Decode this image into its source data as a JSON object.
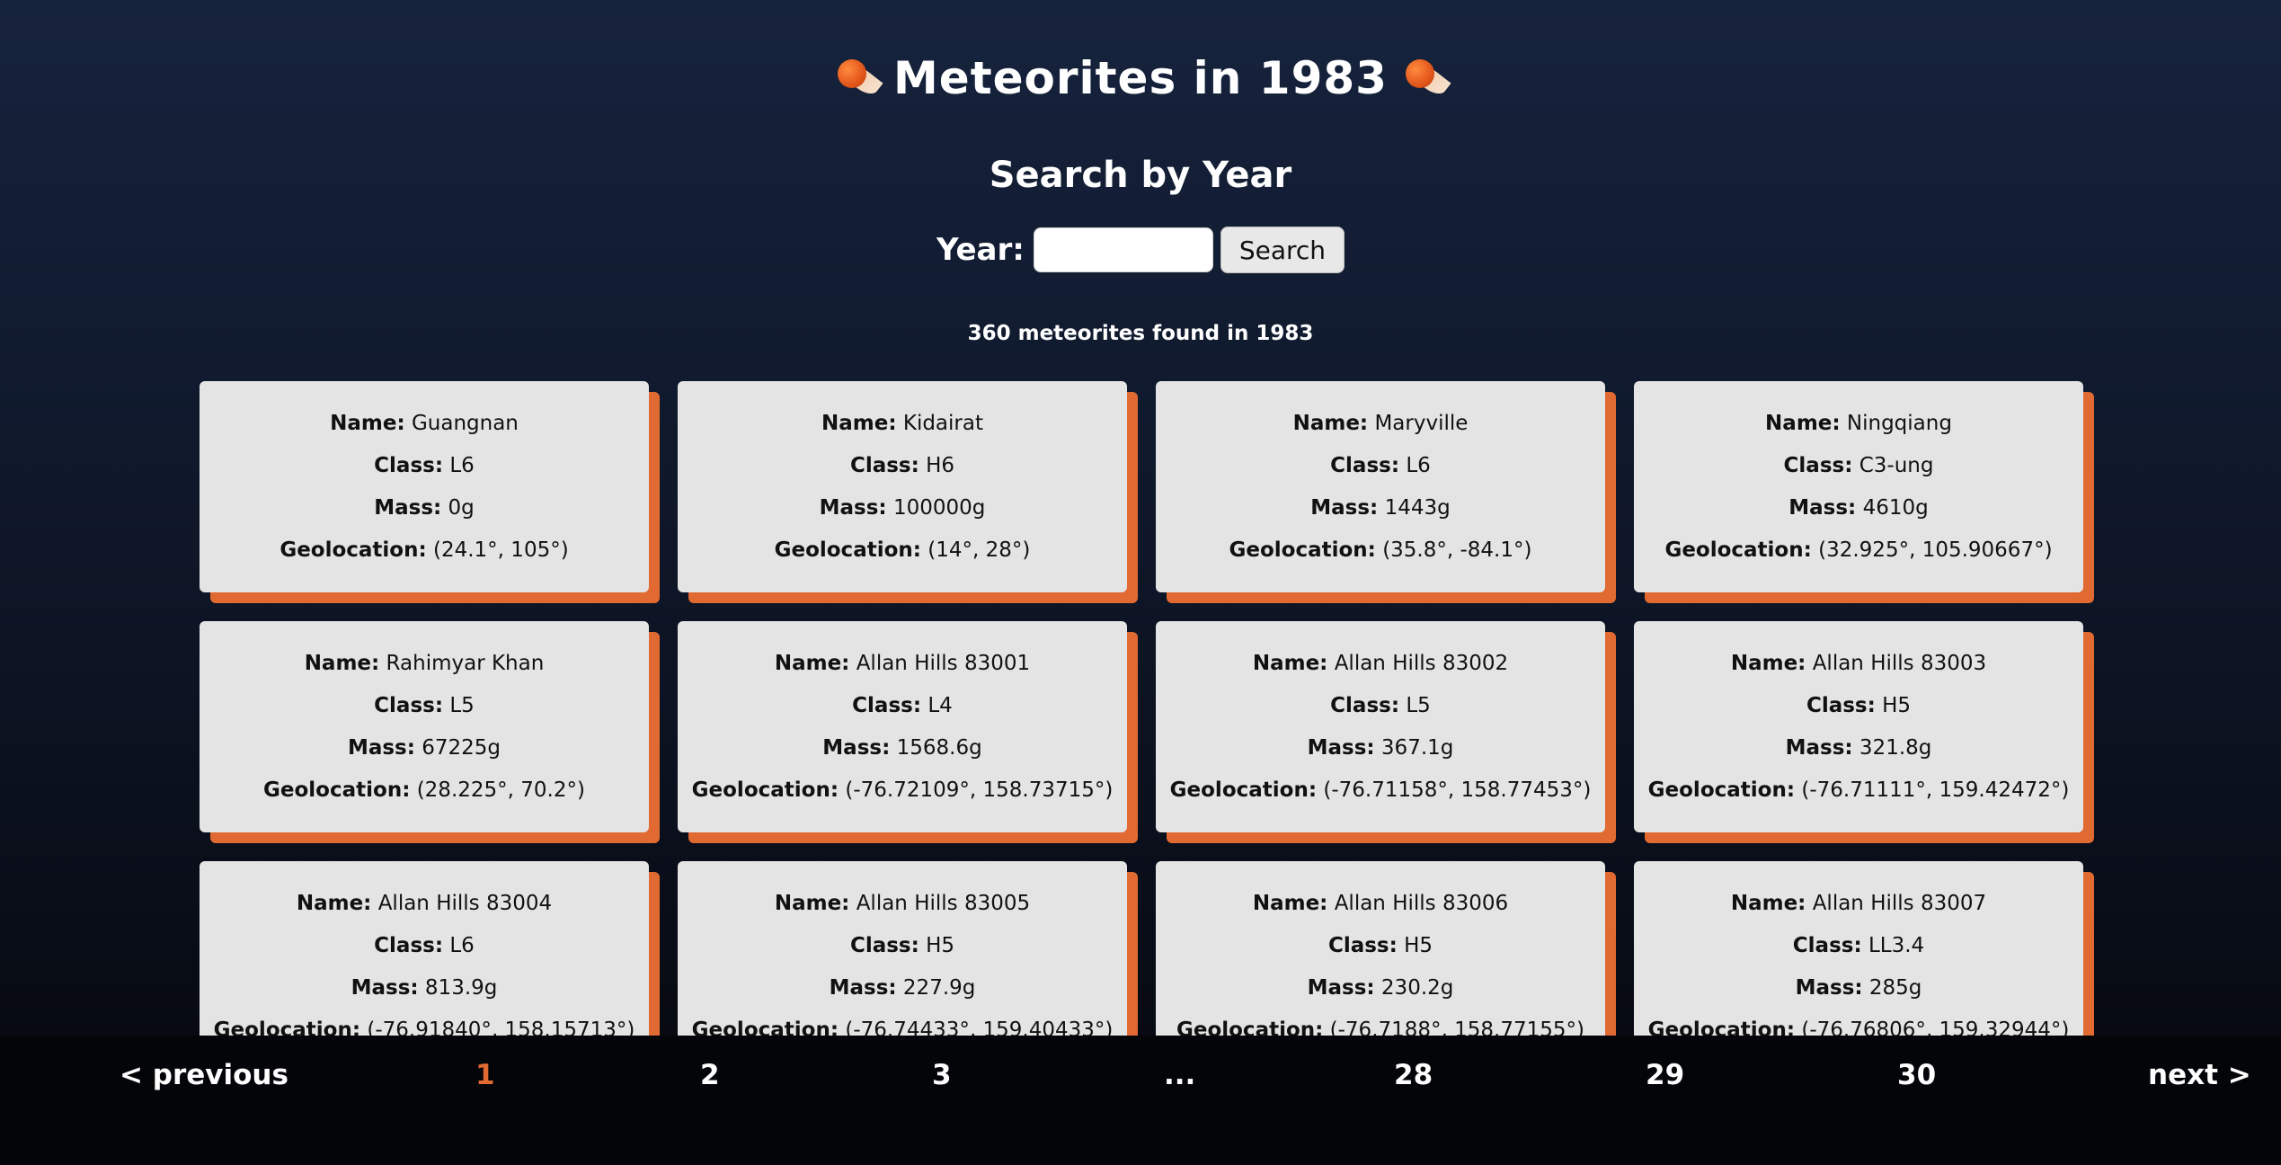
{
  "header": {
    "title": "Meteorites in 1983",
    "left_icon": "meteor-icon",
    "right_icon": "meteor-icon"
  },
  "search": {
    "heading": "Search by Year",
    "label": "Year:",
    "input_value": "",
    "button_label": "Search"
  },
  "results": {
    "count_text": "360 meteorites found in 1983"
  },
  "field_labels": {
    "name": "Name:",
    "class": "Class:",
    "mass": "Mass:",
    "geolocation": "Geolocation:"
  },
  "meteorites": [
    {
      "name": "Guangnan",
      "class": "L6",
      "mass": "0g",
      "geolocation": "(24.1°, 105°)"
    },
    {
      "name": "Kidairat",
      "class": "H6",
      "mass": "100000g",
      "geolocation": "(14°, 28°)"
    },
    {
      "name": "Maryville",
      "class": "L6",
      "mass": "1443g",
      "geolocation": "(35.8°, -84.1°)"
    },
    {
      "name": "Ningqiang",
      "class": "C3-ung",
      "mass": "4610g",
      "geolocation": "(32.925°, 105.90667°)"
    },
    {
      "name": "Rahimyar Khan",
      "class": "L5",
      "mass": "67225g",
      "geolocation": "(28.225°, 70.2°)"
    },
    {
      "name": "Allan Hills 83001",
      "class": "L4",
      "mass": "1568.6g",
      "geolocation": "(-76.72109°, 158.73715°)"
    },
    {
      "name": "Allan Hills 83002",
      "class": "L5",
      "mass": "367.1g",
      "geolocation": "(-76.71158°, 158.77453°)"
    },
    {
      "name": "Allan Hills 83003",
      "class": "H5",
      "mass": "321.8g",
      "geolocation": "(-76.71111°, 159.42472°)"
    },
    {
      "name": "Allan Hills 83004",
      "class": "L6",
      "mass": "813.9g",
      "geolocation": "(-76.91840°, 158.15713°)"
    },
    {
      "name": "Allan Hills 83005",
      "class": "H5",
      "mass": "227.9g",
      "geolocation": "(-76.74433°, 159.40433°)"
    },
    {
      "name": "Allan Hills 83006",
      "class": "H5",
      "mass": "230.2g",
      "geolocation": "(-76.7188°, 158.77155°)"
    },
    {
      "name": "Allan Hills 83007",
      "class": "LL3.4",
      "mass": "285g",
      "geolocation": "(-76.76806°, 159.32944°)"
    }
  ],
  "pagination": {
    "previous_label": "< previous",
    "next_label": "next >",
    "pages": [
      "1",
      "2",
      "3",
      "...",
      "28",
      "29",
      "30"
    ],
    "current_page": "1"
  }
}
